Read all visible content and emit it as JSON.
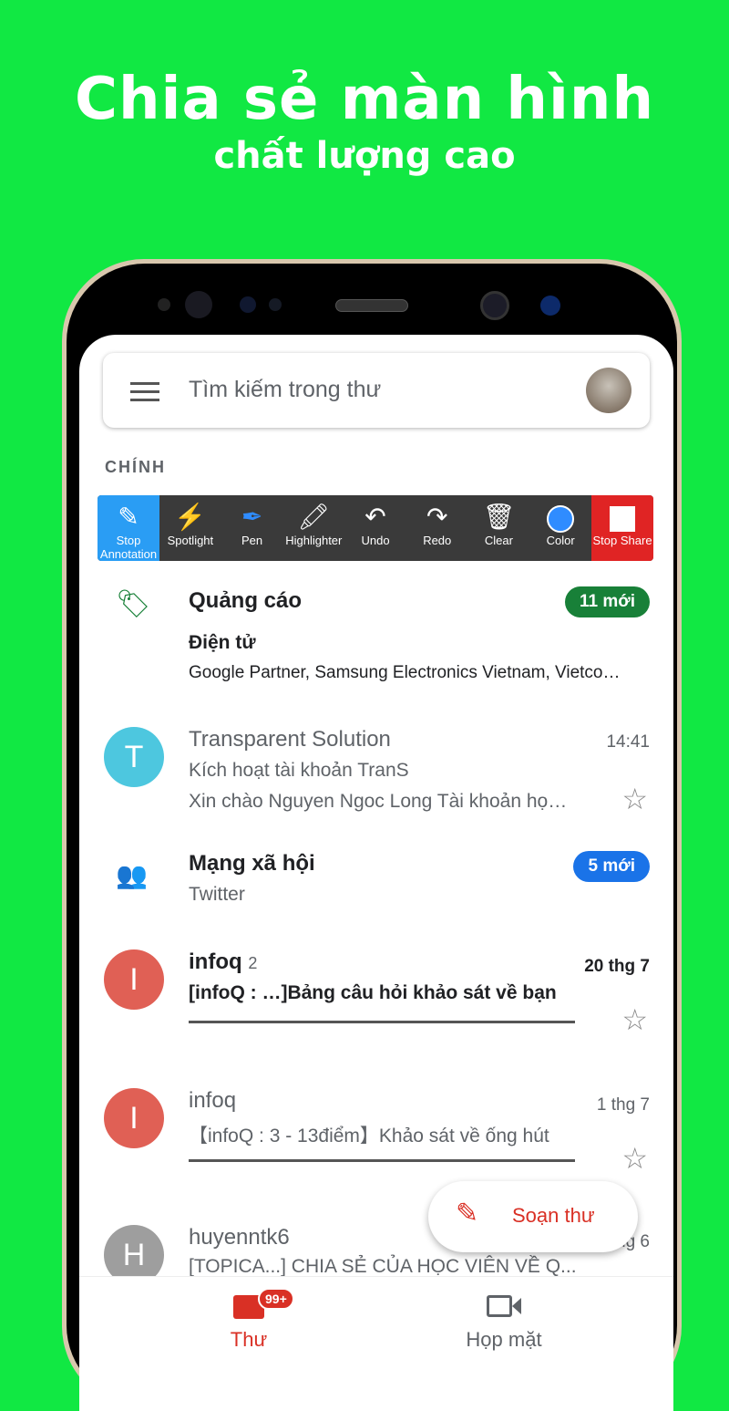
{
  "promo": {
    "title": "Chia sẻ màn hình",
    "subtitle": "chất lượng cao"
  },
  "search": {
    "placeholder": "Tìm kiếm trong thư"
  },
  "section": "CHÍNH",
  "toolbar": [
    {
      "label": "Stop Annotation",
      "icon": "pencil-icon"
    },
    {
      "label": "Spotlight",
      "icon": "magic-wand-icon"
    },
    {
      "label": "Pen",
      "icon": "pen-icon"
    },
    {
      "label": "Highlighter",
      "icon": "highlighter-icon"
    },
    {
      "label": "Undo",
      "icon": "undo-icon"
    },
    {
      "label": "Redo",
      "icon": "redo-icon"
    },
    {
      "label": "Clear",
      "icon": "trash-icon"
    },
    {
      "label": "Color",
      "icon": "color-circle-icon"
    },
    {
      "label": "Stop Share",
      "icon": "stop-square-icon"
    }
  ],
  "colors": {
    "accent": "#d93025",
    "annotation": "#2a9df4",
    "stop": "#e02424",
    "promo_badge": "#188038",
    "social_badge": "#1a73e8",
    "pen_color": "#2f8cff"
  },
  "categories": [
    {
      "title": "Quảng cáo",
      "subtitle": "Điện tử",
      "snippet": "Google Partner, Samsung Electronics Vietnam, Vietco…",
      "badge": "11 mới",
      "icon": "tag-icon"
    },
    {
      "title": "Mạng xã hội",
      "subtitle": "Twitter",
      "badge": "5 mới",
      "icon": "people-icon"
    }
  ],
  "emails": [
    {
      "initial": "T",
      "sender": "Transparent Solution",
      "subject": "Kích hoạt tài khoản TranS",
      "snippet": "Xin chào Nguyen Ngoc Long Tài khoản họ…",
      "date": "14:41",
      "color": "#4dc7df"
    },
    {
      "initial": "I",
      "sender": "infoq",
      "count": "2",
      "subject": "[infoQ : …]Bảng câu hỏi khảo sát về bạn",
      "date": "20 thg 7",
      "color": "#e06055"
    },
    {
      "initial": "I",
      "sender": "infoq",
      "subject": "【infoQ : 3 - 13điểm】Khảo sát về ống hút",
      "date": "1 thg 7",
      "color": "#e06055"
    },
    {
      "initial": "H",
      "sender": "huyenntk6",
      "subject": "[TOPICA...] CHIA SẺ CỦA HỌC VIÊN VỀ Q...",
      "date": "thg 6",
      "color": "#9e9e9e"
    }
  ],
  "compose": "Soạn thư",
  "nav": {
    "mail": "Thư",
    "mail_badge": "99+",
    "meet": "Họp mặt"
  }
}
